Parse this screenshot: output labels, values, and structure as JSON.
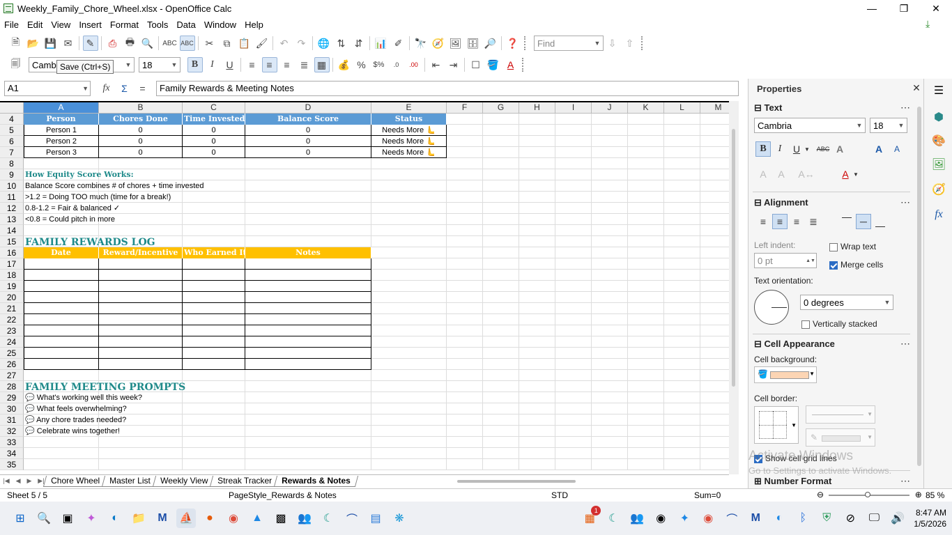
{
  "window": {
    "title": "Weekly_Family_Chore_Wheel.xlsx - OpenOffice Calc",
    "min": "—",
    "max": "❐",
    "close": "✕"
  },
  "menu": [
    "File",
    "Edit",
    "View",
    "Insert",
    "Format",
    "Tools",
    "Data",
    "Window",
    "Help"
  ],
  "toolbar": {
    "find_placeholder": "Find",
    "font_name": "Camb",
    "font_size": "18",
    "tooltip": "Save (Ctrl+S)"
  },
  "formula_bar": {
    "cell_ref": "A1",
    "content": "Family Rewards & Meeting Notes"
  },
  "columns": [
    "A",
    "B",
    "C",
    "D",
    "E",
    "F",
    "G",
    "H",
    "I",
    "J",
    "K",
    "L",
    "M"
  ],
  "rows": [
    "4",
    "5",
    "6",
    "7",
    "8",
    "9",
    "10",
    "11",
    "12",
    "13",
    "14",
    "15",
    "16",
    "17",
    "18",
    "19",
    "20",
    "21",
    "22",
    "23",
    "24",
    "25",
    "26",
    "27",
    "28",
    "29",
    "30",
    "31",
    "32",
    "33",
    "34",
    "35"
  ],
  "sheet": {
    "equity_headers": [
      "Person",
      "Chores Done",
      "Time Invested",
      "Balance Score",
      "Status"
    ],
    "equity_rows": [
      [
        "Person 1",
        "0",
        "0",
        "0",
        "Needs More 🫷"
      ],
      [
        "Person 2",
        "0",
        "0",
        "0",
        "Needs More 🫷"
      ],
      [
        "Person 3",
        "0",
        "0",
        "0",
        "Needs More 🫷"
      ]
    ],
    "how_title": "How Equity Score Works:",
    "how_lines": [
      "Balance Score combines # of chores + time invested",
      ">1.2 = Doing TOO much (time for a break!)",
      "0.8-1.2 = Fair & balanced ✓",
      "<0.8 = Could pitch in more"
    ],
    "rewards_title": "FAMILY REWARDS LOG",
    "rewards_headers": [
      "Date",
      "Reward/Incentive",
      "Who Earned It",
      "Notes"
    ],
    "meeting_title": "FAMILY MEETING PROMPTS",
    "prompts": [
      "💬 What's working well this week?",
      "💬 What feels overwhelming?",
      "💬 Any chore trades needed?",
      "💬 Celebrate wins together!"
    ]
  },
  "tabs": [
    "Chore Wheel",
    "Master List",
    "Weekly View",
    "Streak Tracker",
    "Rewards & Notes"
  ],
  "active_tab": "Rewards & Notes",
  "status": {
    "sheet": "Sheet 5 / 5",
    "page_style": "PageStyle_Rewards & Notes",
    "mode": "STD",
    "sum": "Sum=0",
    "zoom": "85 %"
  },
  "sidebar": {
    "title": "Properties",
    "text_section": "Text",
    "font": "Cambria",
    "size": "18",
    "alignment_section": "Alignment",
    "left_indent_label": "Left indent:",
    "left_indent_value": "0 pt",
    "wrap_text": "Wrap text",
    "merge_cells": "Merge cells",
    "text_orientation_label": "Text orientation:",
    "orientation_value": "0 degrees",
    "vertically_stacked": "Vertically stacked",
    "cell_appearance_section": "Cell Appearance",
    "cell_background_label": "Cell background:",
    "cell_background_color": "#fcd5b4",
    "cell_border_label": "Cell border:",
    "show_grid_lines": "Show cell grid lines",
    "number_format_section": "Number Format"
  },
  "watermark": {
    "line1": "Activate Windows",
    "line2": "Go to Settings to activate Windows."
  },
  "taskbar": {
    "time": "8:47 AM",
    "date": "1/5/2026",
    "badge": "1"
  },
  "colors": {
    "blue_header": "#5b9bd5",
    "yellow_header": "#ffc000",
    "section_teal": "#1f8a8a",
    "selection": "#4a90d9"
  }
}
